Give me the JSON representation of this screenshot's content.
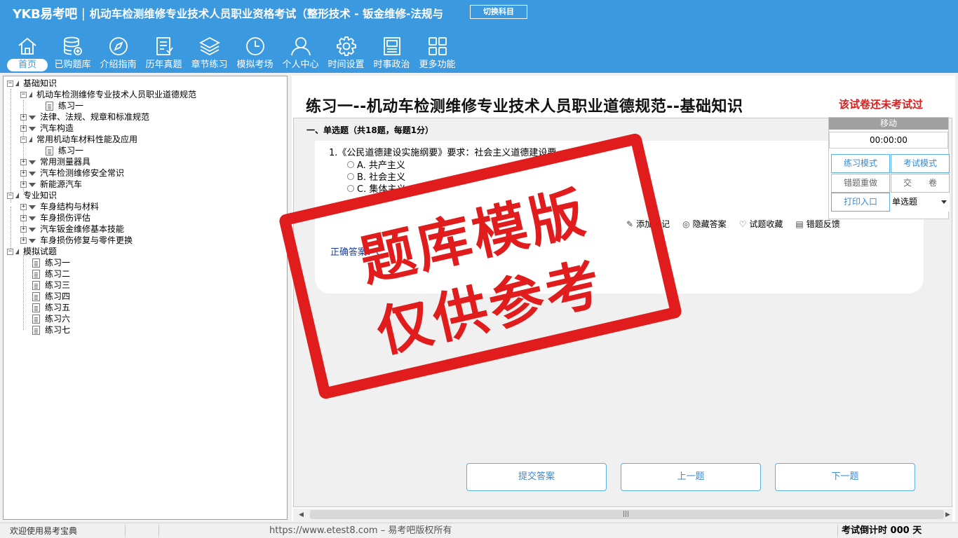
{
  "header": {
    "logo": "YKB易考吧",
    "separator": "|",
    "title": "机动车检测维修专业技术人员职业资格考试（整形技术 - 钣金维修-法规与",
    "switch_label": "切换科目"
  },
  "nav": [
    {
      "label": "首页",
      "icon": "home-icon"
    },
    {
      "label": "已购题库",
      "icon": "database-icon"
    },
    {
      "label": "介绍指南",
      "icon": "compass-icon"
    },
    {
      "label": "历年真题",
      "icon": "list-icon"
    },
    {
      "label": "章节练习",
      "icon": "layers-icon"
    },
    {
      "label": "模拟考场",
      "icon": "clock-icon"
    },
    {
      "label": "个人中心",
      "icon": "user-icon"
    },
    {
      "label": "时间设置",
      "icon": "gear-icon"
    },
    {
      "label": "时事政治",
      "icon": "news-icon"
    },
    {
      "label": "更多功能",
      "icon": "grid-icon"
    }
  ],
  "tree": [
    "基础知识",
    "机动车检测维修专业技术人员职业道德规范",
    "练习一",
    "法律、法规、规章和标准规范",
    "汽车构造",
    "常用机动车材料性能及应用",
    "练习一",
    "常用测量器具",
    "汽车检测维修安全常识",
    "新能源汽车",
    "专业知识",
    "车身结构与材料",
    "车身损伤评估",
    "汽车钣金维修基本技能",
    "车身损伤修复与零件更换",
    "模拟试题",
    "练习一",
    "练习二",
    "练习三",
    "练习四",
    "练习五",
    "练习六",
    "练习七"
  ],
  "main": {
    "exercise_title": "练习一--机动车检测维修专业技术人员职业道德规范--基础知识",
    "not_tested": "该试卷还未考试过",
    "section_title": "一、单选题（共18题，每题1分）",
    "question": "1.《公民道德建设实施纲要》要求：社会主义道德建设要",
    "options": [
      "A. 共产主义",
      "B. 社会主义",
      "C. 集体主义"
    ],
    "toolbar": [
      "添加笔记",
      "隐藏答案",
      "试题收藏",
      "错题反馈"
    ],
    "correct_answer": "正确答案：C",
    "buttons": {
      "submit": "提交答案",
      "prev": "上一题",
      "next": "下一题"
    }
  },
  "float_panel": {
    "move": "移动",
    "timer": "00:00:00",
    "practice_mode": "练习模式",
    "exam_mode": "考试模式",
    "redo_wrong": "错题重做",
    "submit_paper": "交　　卷",
    "print": "打印入口",
    "question_type": "单选题"
  },
  "status": {
    "welcome": "欢迎使用易考宝典",
    "copyright": "https://www.etest8.com – 易考吧版权所有",
    "countdown": "考试倒计时 000 天"
  },
  "watermark": {
    "line1": "题库模版",
    "line2": "仅供参考"
  },
  "colors": {
    "header": "#3b99e0",
    "stamp": "#e01c1c",
    "alert": "#d42020",
    "button_border": "#5ab0e8"
  }
}
